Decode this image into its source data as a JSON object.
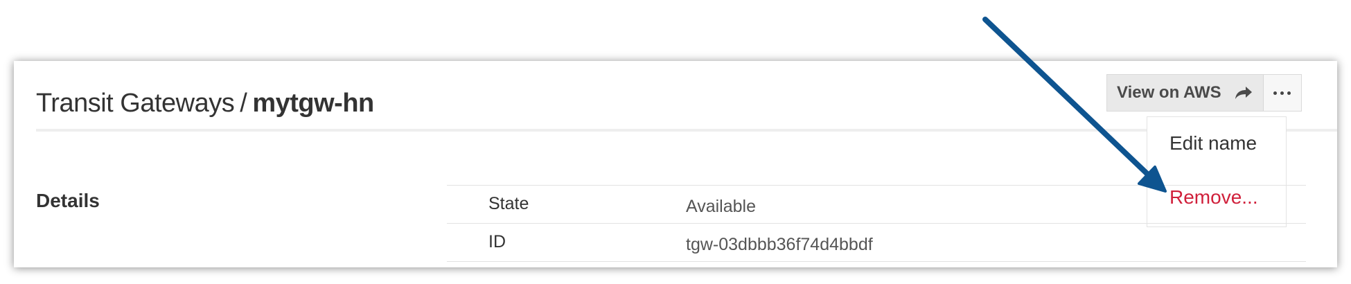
{
  "header": {
    "breadcrumb_parent": "Transit Gateways",
    "separator": "/",
    "current_name": "mytgw-hn"
  },
  "toolbar": {
    "view_on_aws_label": "View on AWS",
    "view_on_aws_icon": "share-arrow-icon",
    "more_icon": "ellipsis-icon"
  },
  "menu": {
    "items": [
      {
        "label": "Edit name",
        "color": "#333333"
      },
      {
        "label": "Remove...",
        "color": "#d0203b"
      }
    ]
  },
  "details": {
    "section_title": "Details",
    "rows": [
      {
        "key": "State",
        "value": "Available"
      },
      {
        "key": "ID",
        "value": "tgw-03dbbb36f74d4bbdf"
      }
    ]
  },
  "annotation": {
    "arrow_color": "#0e5490"
  }
}
